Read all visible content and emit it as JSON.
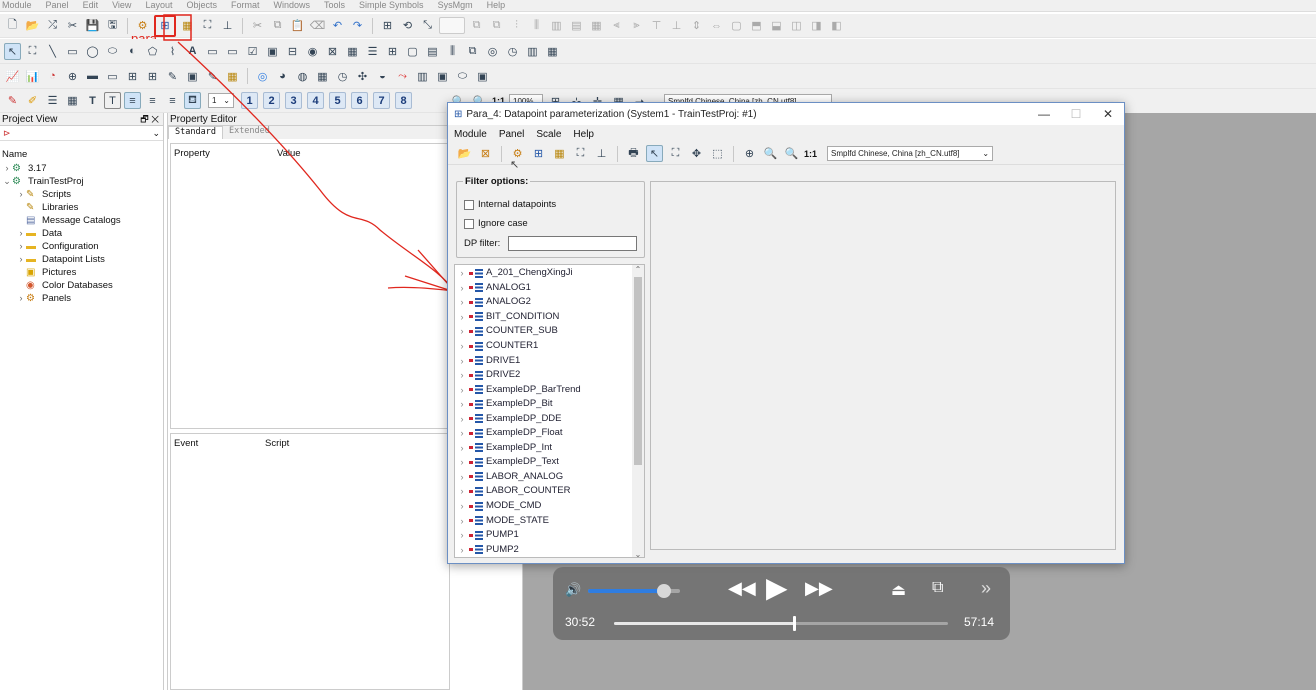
{
  "main_menu": [
    "Module",
    "Panel",
    "Edit",
    "View",
    "Layout",
    "Objects",
    "Format",
    "Windows",
    "Tools",
    "Simple Symbols",
    "SysMgm",
    "Help"
  ],
  "annotation_label": "para",
  "zoom_value": "100%",
  "lang_combo": "Smplfd Chinese, China [zh_CN.utf8]",
  "line_width": "1",
  "num_buttons": [
    "1",
    "2",
    "3",
    "4",
    "5",
    "6",
    "7",
    "8"
  ],
  "project_view": {
    "title": "Project View",
    "column": "Name",
    "items": [
      {
        "label": "3.17",
        "level": 0,
        "expand": "›",
        "icon": "project"
      },
      {
        "label": "TrainTestProj",
        "level": 0,
        "expand": "⌄",
        "icon": "project"
      },
      {
        "label": "Scripts",
        "level": 1,
        "expand": "›",
        "icon": "script"
      },
      {
        "label": "Libraries",
        "level": 1,
        "expand": "",
        "icon": "script"
      },
      {
        "label": "Message Catalogs",
        "level": 1,
        "expand": "",
        "icon": "catalog"
      },
      {
        "label": "Data",
        "level": 1,
        "expand": "›",
        "icon": "folder"
      },
      {
        "label": "Configuration",
        "level": 1,
        "expand": "›",
        "icon": "folder"
      },
      {
        "label": "Datapoint Lists",
        "level": 1,
        "expand": "›",
        "icon": "folder"
      },
      {
        "label": "Pictures",
        "level": 1,
        "expand": "",
        "icon": "picture"
      },
      {
        "label": "Color Databases",
        "level": 1,
        "expand": "",
        "icon": "color"
      },
      {
        "label": "Panels",
        "level": 1,
        "expand": "›",
        "icon": "panel"
      }
    ]
  },
  "property_editor": {
    "title": "Property Editor",
    "tabs": [
      "Standard",
      "Extended"
    ],
    "columns": [
      "Property",
      "Value"
    ],
    "event_columns": [
      "Event",
      "Script"
    ]
  },
  "dialog": {
    "title": "Para_4: Datapoint parameterization (System1 - TrainTestProj: #1)",
    "menu": [
      "Module",
      "Panel",
      "Scale",
      "Help"
    ],
    "zoom_label": "1:1",
    "lang_combo": "Smplfd Chinese, China [zh_CN.utf8]",
    "filter": {
      "title": "Filter options:",
      "internal_label": "Internal datapoints",
      "ignore_case_label": "Ignore case",
      "dp_filter_label": "DP filter:",
      "dp_filter_value": ""
    },
    "datapoints": [
      "A_201_ChengXingJi",
      "ANALOG1",
      "ANALOG2",
      "BIT_CONDITION",
      "COUNTER_SUB",
      "COUNTER1",
      "DRIVE1",
      "DRIVE2",
      "ExampleDP_BarTrend",
      "ExampleDP_Bit",
      "ExampleDP_DDE",
      "ExampleDP_Float",
      "ExampleDP_Int",
      "ExampleDP_Text",
      "LABOR_ANALOG",
      "LABOR_COUNTER",
      "MODE_CMD",
      "MODE_STATE",
      "PUMP1",
      "PUMP2"
    ]
  },
  "video": {
    "elapsed": "30:52",
    "total": "57:14",
    "progress": 0.54,
    "volume": 0.83
  },
  "colors": {
    "annotation": "#e0271e",
    "accent": "#2f7de1",
    "window_border": "#6b8fc4"
  }
}
